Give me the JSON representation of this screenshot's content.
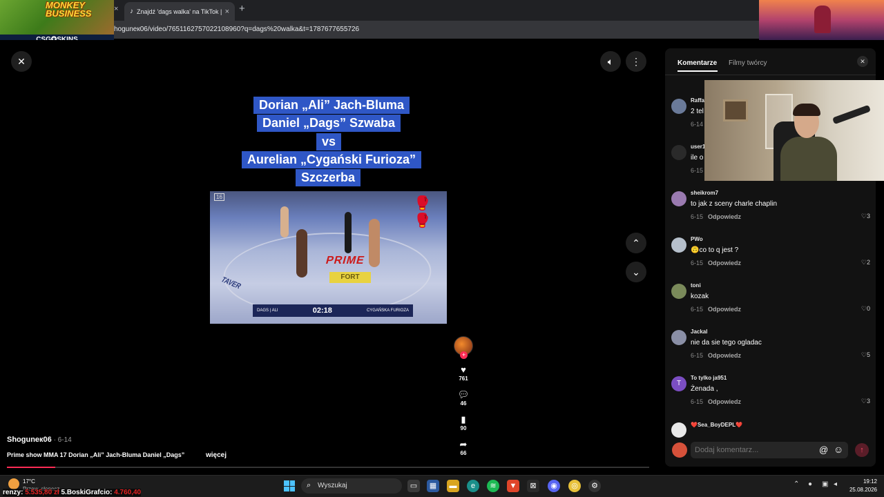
{
  "browser": {
    "tab_title": "Znajdź 'dags walka' na TikTok |",
    "tab_close": "×",
    "new_tab": "+",
    "url": "hoguneк06/video/765116275702210896​0?q=dags%20walka&t=1787677655726"
  },
  "overlay": {
    "monkey_title": "MONKEY BUSINESS",
    "sponsor": "CSG✪SKINS"
  },
  "viewer": {
    "close_icon": "close-icon",
    "caption_lines": [
      "Dorian „Ali” Jach-Bluma",
      "Daniel „Dags” Szwaba",
      "vs",
      "Aurelian „Cygański Furioza”",
      "Szczerba"
    ],
    "video": {
      "age_badge": "16",
      "floor_brand": "PRIME",
      "floor_sponsor": "FORT",
      "side_brand": "TAVER",
      "score_left": "DAGS | ALI",
      "timer": "02:18",
      "score_right": "CYGAŃSKA FURIOZA"
    },
    "actions": {
      "likes": "761",
      "comments": "46",
      "saves": "90",
      "shares": "66"
    },
    "author": "Shoguneк06",
    "date": " · 6-14",
    "description": "Prime show MMA 17 Dorian „Ali” Jach-Bluma Daniel „Dags”",
    "more": "więcej",
    "progress_fraction": 0.075
  },
  "panel": {
    "tab_comments": "Komentarze",
    "tab_videos": "Filmy twórcy",
    "reply_label": "Odpowiedz",
    "comments": [
      {
        "user": "Raffa",
        "text": "2 tel",
        "date": "6-14",
        "likes": ""
      },
      {
        "user": "user1",
        "text": "ile o",
        "date": "6-15",
        "likes": ""
      },
      {
        "user": "sheikrom7",
        "text": "to jak z sceny charle chaplin",
        "date": "6-15",
        "likes": "3"
      },
      {
        "user": "PWo",
        "text": "🙃co to q jest ?",
        "date": "6-15",
        "likes": "2"
      },
      {
        "user": "toni",
        "text": "kozak",
        "date": "6-15",
        "likes": "0"
      },
      {
        "user": "Jackal",
        "text": "nie da sie tego ogladac",
        "date": "6-15",
        "likes": "5"
      },
      {
        "user": "To tylko ja951",
        "text": "Żenada ,",
        "date": "6-15",
        "likes": "3",
        "initial": "T"
      },
      {
        "user": "❤️Sea_BoyDEPL❤️",
        "text": "",
        "date": "",
        "likes": ""
      }
    ],
    "input_placeholder": "Dodaj komentarz..."
  },
  "taskbar": {
    "weather_temp": "17°C",
    "weather_desc": "Przew. słonecz",
    "ticker_prefix": "renzy: ",
    "ticker_red_1": "5.535,80 zł",
    "ticker_mid": " 5.BoskiGrafcio: ",
    "ticker_red_2": "4.760,40",
    "search_label": "Wyszukaj",
    "time": "19:12",
    "date": "25.08.2026"
  },
  "colors": {
    "accent": "#fe2c55",
    "caption_bg": "#2f57c6",
    "panel_bg": "#121212"
  }
}
